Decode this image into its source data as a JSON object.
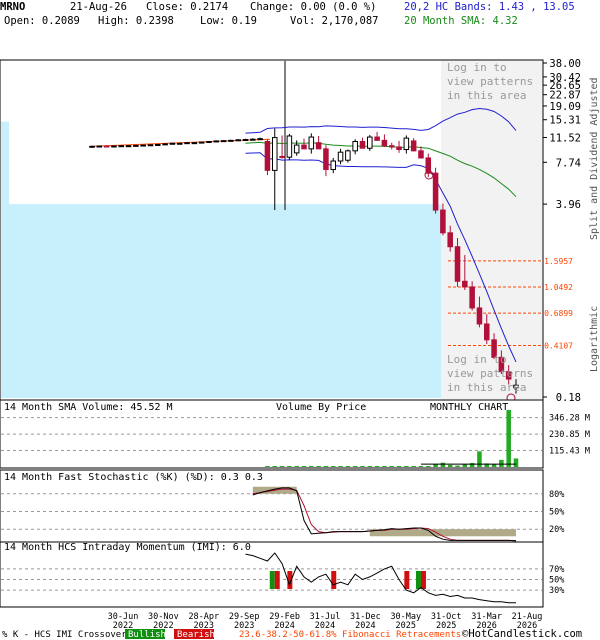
{
  "header": {
    "symbol": "MRNO",
    "date": "21-Aug-26",
    "close": "Close: 0.2174",
    "change": "Change: 0.00 (0.0 %)",
    "open": "Open: 0.2089",
    "high": "High: 0.2398",
    "low": "Low: 0.19",
    "vol": "Vol: 2,170,087",
    "hc_bands": "20,2 HC Bands: 1.43 , 13.05",
    "sma": "20 Month SMA: 4.32"
  },
  "colors": {
    "up": "#000000",
    "down": "#b0103a",
    "upper_band": "#2020d0",
    "lower_band": "#2020d0",
    "sma": "#1a8a1a",
    "fib": "#ff4400",
    "volume_bar": "#22aa22",
    "vbp": "#c8f0fc",
    "stoch_k": "#000000",
    "stoch_d": "#b01030",
    "shade": "#b0aa88"
  },
  "labels": {
    "pattern_msg": "Log in to view patterns in this area",
    "pattern_lines": [
      "Log in to",
      "view patterns",
      "in this area"
    ],
    "split_adj": "Split and Dividend Adjusted",
    "logarithmic": "Logarithmic",
    "volume_sma": "14 Month SMA Volume: 45.52 M",
    "vbp": "Volume By Price",
    "monthly": "MONTHLY CHART",
    "stoch": "14 Month Fast Stochastic (%K) (%D): 0.3   0.3",
    "imi": "14 Month HCS Intraday Momentum (IMI): 6.0",
    "legend_prefix": "% K - HCS IMI Crossover:",
    "bullish": "Bullish",
    "bearish": "Bearish",
    "fib_legend": "23.6-38.2-50-61.8% Fibonacci Retracements",
    "copyright": "©HotCandlestick.com"
  },
  "chart_data": [
    {
      "type": "candlestick",
      "title": "",
      "scale": "log",
      "price_ticks": [
        "38.00",
        "30.42",
        "26.65",
        "22.87",
        "19.09",
        "15.31",
        "11.52",
        "7.74",
        "3.96",
        "0.18"
      ],
      "fib_levels": [
        "1.5957",
        "1.0492",
        "0.6899",
        "0.4107"
      ],
      "x_ticks": [
        "30-Jun 2022",
        "30-Nov 2022",
        "28-Apr 2023",
        "29-Sep 2023",
        "29-Feb 2024",
        "31-Jul 2024",
        "31-Dec 2024",
        "30-May 2025",
        "31-Oct 2025",
        "31-Mar 2026",
        "21-Aug 2026"
      ],
      "candles": [
        {
          "o": 10.0,
          "h": 10.1,
          "l": 9.95,
          "c": 10.0
        },
        {
          "o": 10.0,
          "h": 10.1,
          "l": 9.95,
          "c": 10.05
        },
        {
          "o": 10.05,
          "h": 10.1,
          "l": 9.95,
          "c": 10.0
        },
        {
          "o": 10.0,
          "h": 10.1,
          "l": 9.95,
          "c": 10.05
        },
        {
          "o": 10.05,
          "h": 10.15,
          "l": 10.0,
          "c": 10.1
        },
        {
          "o": 10.1,
          "h": 10.15,
          "l": 10.05,
          "c": 10.1
        },
        {
          "o": 10.1,
          "h": 10.2,
          "l": 10.05,
          "c": 10.15
        },
        {
          "o": 10.15,
          "h": 10.2,
          "l": 10.1,
          "c": 10.2
        },
        {
          "o": 10.2,
          "h": 10.3,
          "l": 10.1,
          "c": 10.25
        },
        {
          "o": 10.25,
          "h": 10.4,
          "l": 10.2,
          "c": 10.3
        },
        {
          "o": 10.3,
          "h": 10.5,
          "l": 10.2,
          "c": 10.4
        },
        {
          "o": 10.4,
          "h": 10.6,
          "l": 10.3,
          "c": 10.5
        },
        {
          "o": 10.5,
          "h": 10.6,
          "l": 10.4,
          "c": 10.5
        },
        {
          "o": 10.5,
          "h": 10.7,
          "l": 10.4,
          "c": 10.6
        },
        {
          "o": 10.6,
          "h": 10.7,
          "l": 10.5,
          "c": 10.6
        },
        {
          "o": 10.6,
          "h": 10.8,
          "l": 10.5,
          "c": 10.7
        },
        {
          "o": 10.7,
          "h": 10.9,
          "l": 10.6,
          "c": 10.8
        },
        {
          "o": 10.8,
          "h": 11.0,
          "l": 10.7,
          "c": 10.9
        },
        {
          "o": 10.9,
          "h": 11.0,
          "l": 10.8,
          "c": 10.95
        },
        {
          "o": 10.95,
          "h": 11.1,
          "l": 10.8,
          "c": 11.0
        },
        {
          "o": 11.0,
          "h": 11.2,
          "l": 10.9,
          "c": 11.1
        },
        {
          "o": 11.1,
          "h": 11.3,
          "l": 11.0,
          "c": 11.15
        },
        {
          "o": 11.15,
          "h": 11.4,
          "l": 11.0,
          "c": 11.2
        },
        {
          "o": 11.2,
          "h": 11.5,
          "l": 11.1,
          "c": 11.3
        },
        {
          "o": 10.8,
          "h": 11.2,
          "l": 6.3,
          "c": 6.8
        },
        {
          "o": 6.8,
          "h": 13.3,
          "l": 3.6,
          "c": 11.5
        },
        {
          "o": 8.5,
          "h": 11.9,
          "l": 8.2,
          "c": 8.4
        },
        {
          "o": 8.4,
          "h": 12.2,
          "l": 8.0,
          "c": 11.8
        },
        {
          "o": 9.0,
          "h": 11.0,
          "l": 8.6,
          "c": 10.2
        },
        {
          "o": 10.2,
          "h": 11.3,
          "l": 9.8,
          "c": 9.6
        },
        {
          "o": 9.6,
          "h": 12.3,
          "l": 8.9,
          "c": 11.6
        },
        {
          "o": 10.6,
          "h": 11.8,
          "l": 9.6,
          "c": 9.6
        },
        {
          "o": 9.6,
          "h": 10.2,
          "l": 6.2,
          "c": 6.9
        },
        {
          "o": 6.9,
          "h": 8.3,
          "l": 6.5,
          "c": 7.9
        },
        {
          "o": 7.9,
          "h": 9.6,
          "l": 7.5,
          "c": 9.1
        },
        {
          "o": 8.0,
          "h": 9.5,
          "l": 7.7,
          "c": 9.3
        },
        {
          "o": 9.3,
          "h": 11.2,
          "l": 8.8,
          "c": 10.8
        },
        {
          "o": 10.8,
          "h": 11.5,
          "l": 10.0,
          "c": 9.7
        },
        {
          "o": 9.7,
          "h": 12.0,
          "l": 9.3,
          "c": 11.6
        },
        {
          "o": 11.6,
          "h": 12.6,
          "l": 10.9,
          "c": 11.0
        },
        {
          "o": 11.0,
          "h": 12.1,
          "l": 9.9,
          "c": 10.1
        },
        {
          "o": 10.1,
          "h": 10.6,
          "l": 9.5,
          "c": 9.9
        },
        {
          "o": 9.9,
          "h": 10.9,
          "l": 9.0,
          "c": 9.5
        },
        {
          "o": 9.5,
          "h": 11.9,
          "l": 8.9,
          "c": 11.4
        },
        {
          "o": 10.9,
          "h": 11.4,
          "l": 9.2,
          "c": 9.3
        },
        {
          "o": 9.3,
          "h": 10.0,
          "l": 8.2,
          "c": 8.3
        },
        {
          "o": 8.3,
          "h": 8.9,
          "l": 6.1,
          "c": 6.5
        },
        {
          "o": 6.5,
          "h": 7.1,
          "l": 3.4,
          "c": 3.6
        },
        {
          "o": 3.6,
          "h": 4.0,
          "l": 2.4,
          "c": 2.5
        },
        {
          "o": 2.5,
          "h": 2.8,
          "l": 1.85,
          "c": 2.0
        },
        {
          "o": 2.0,
          "h": 2.3,
          "l": 1.05,
          "c": 1.15
        },
        {
          "o": 1.15,
          "h": 1.75,
          "l": 1.0,
          "c": 1.05
        },
        {
          "o": 1.05,
          "h": 1.15,
          "l": 0.72,
          "c": 0.75
        },
        {
          "o": 0.75,
          "h": 0.9,
          "l": 0.55,
          "c": 0.58
        },
        {
          "o": 0.58,
          "h": 0.68,
          "l": 0.42,
          "c": 0.45
        },
        {
          "o": 0.45,
          "h": 0.5,
          "l": 0.33,
          "c": 0.34
        },
        {
          "o": 0.34,
          "h": 0.38,
          "l": 0.26,
          "c": 0.27
        },
        {
          "o": 0.27,
          "h": 0.3,
          "l": 0.22,
          "c": 0.24
        },
        {
          "o": 0.2089,
          "h": 0.2398,
          "l": 0.19,
          "c": 0.2174
        }
      ]
    },
    {
      "type": "bar",
      "title": "14 Month SMA Volume: 45.52 M",
      "y_ticks": [
        "346.28 M",
        "230.85 M",
        "115.43 M"
      ],
      "ylim": [
        0,
        400
      ],
      "values_m": [
        0,
        0,
        0,
        0,
        0,
        0,
        0,
        0,
        0,
        0,
        0,
        0,
        0,
        0,
        0,
        0,
        0,
        0,
        0,
        0,
        0,
        0,
        0,
        0,
        2,
        4,
        2,
        2,
        1,
        1,
        2,
        1,
        2,
        1,
        1,
        1,
        2,
        1,
        2,
        1,
        1,
        1,
        1,
        2,
        2,
        3,
        6,
        18,
        30,
        15,
        10,
        20,
        28,
        110,
        25,
        20,
        50,
        400,
        60
      ]
    },
    {
      "type": "line",
      "title": "14 Month Fast Stochastic (%K) (%D): 0.3   0.3",
      "y_ticks": [
        "80%",
        "50%",
        "20%"
      ],
      "ylim": [
        0,
        100
      ],
      "k": [
        null,
        null,
        null,
        null,
        null,
        null,
        null,
        null,
        null,
        null,
        null,
        null,
        null,
        null,
        null,
        null,
        null,
        null,
        null,
        null,
        null,
        null,
        78,
        82,
        85,
        88,
        90,
        90,
        85,
        35,
        12,
        13,
        14,
        16,
        16,
        16,
        16,
        16,
        17,
        18,
        19,
        21,
        20,
        21,
        22,
        22,
        18,
        8,
        3,
        1,
        1,
        1,
        1,
        1,
        1,
        1,
        1,
        1,
        0.3
      ],
      "d": [
        null,
        null,
        null,
        null,
        null,
        null,
        null,
        null,
        null,
        null,
        null,
        null,
        null,
        null,
        null,
        null,
        null,
        null,
        null,
        null,
        null,
        null,
        80,
        82,
        84,
        86,
        88,
        88,
        86,
        60,
        28,
        16,
        14,
        15,
        16,
        16,
        16,
        16,
        17,
        18,
        18,
        20,
        20,
        20,
        21,
        22,
        21,
        15,
        8,
        3,
        1,
        1,
        1,
        1,
        1,
        1,
        1,
        1,
        0.3
      ]
    },
    {
      "type": "line",
      "title": "14 Month HCS Intraday Momentum (IMI): 6.0",
      "y_ticks": [
        "70%",
        "50%",
        "30%"
      ],
      "ylim": [
        0,
        100
      ],
      "values": [
        null,
        null,
        null,
        null,
        null,
        null,
        null,
        null,
        null,
        null,
        null,
        null,
        null,
        null,
        null,
        null,
        null,
        null,
        null,
        null,
        null,
        98,
        95,
        90,
        85,
        100,
        80,
        40,
        75,
        55,
        45,
        55,
        60,
        40,
        45,
        40,
        60,
        50,
        55,
        62,
        70,
        75,
        50,
        30,
        25,
        35,
        25,
        20,
        22,
        18,
        20,
        15,
        15,
        12,
        10,
        8,
        8,
        6,
        6
      ],
      "bullish_at": [
        25,
        45
      ],
      "bearish_at": [
        27,
        33,
        43
      ]
    }
  ]
}
